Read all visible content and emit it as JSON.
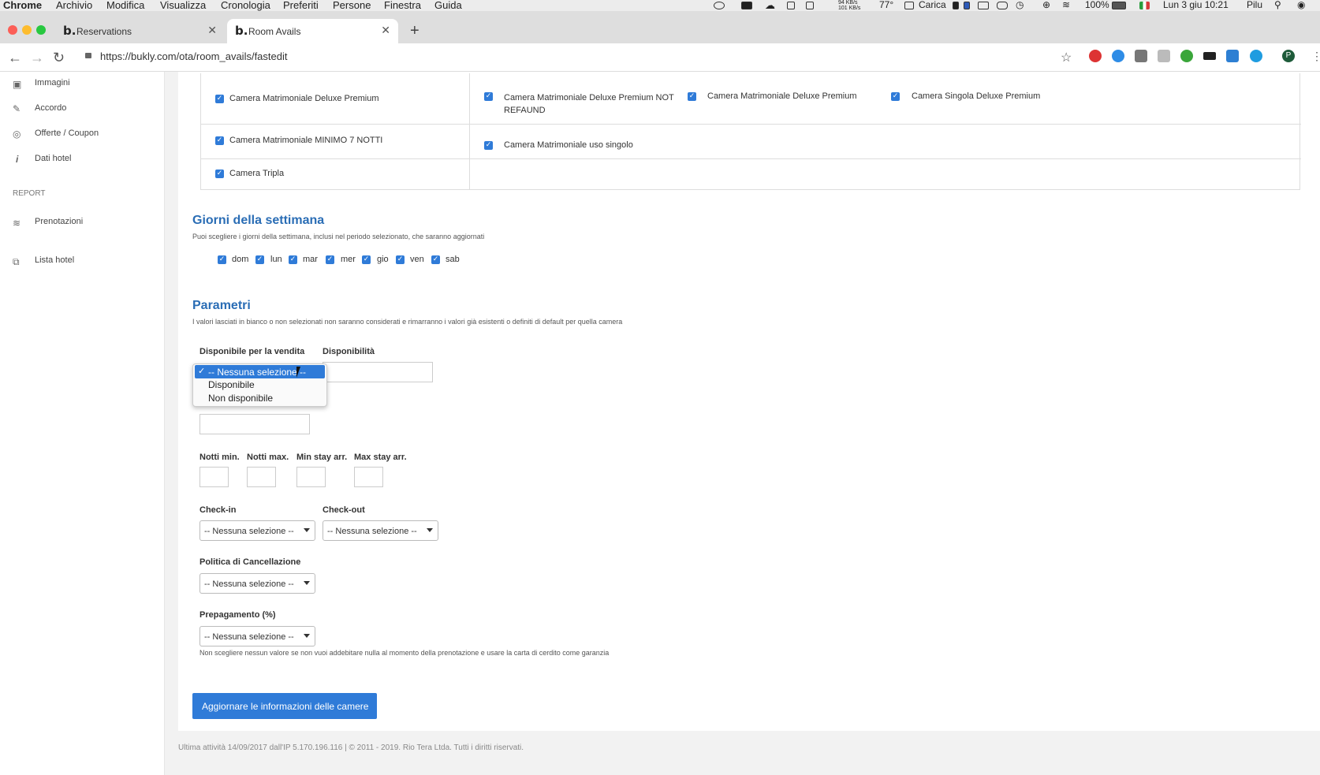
{
  "menubar": {
    "app": "Chrome",
    "items": [
      "Archivio",
      "Modifica",
      "Visualizza",
      "Cronologia",
      "Preferiti",
      "Persone",
      "Finestra",
      "Guida"
    ],
    "status": {
      "net_up": "94 KB/s",
      "net_down": "101 KB/s",
      "temp": "77°",
      "power": "Carica",
      "battery": "100%",
      "datetime": "Lun 3 giu 10:21",
      "user": "Pilu"
    }
  },
  "tabs": [
    {
      "favicon": "b.",
      "label": "Reservations"
    },
    {
      "favicon": "b.",
      "label": "Room Avails"
    }
  ],
  "url": "https://bukly.com/ota/room_avails/fastedit",
  "profile_initial": "P",
  "sidebar": {
    "items": [
      {
        "label": "Immagini",
        "icon": "image-icon"
      },
      {
        "label": "Accordo",
        "icon": "pen-icon"
      },
      {
        "label": "Offerte / Coupon",
        "icon": "target-icon"
      },
      {
        "label": "Dati hotel",
        "icon": "info-icon"
      }
    ],
    "report_label": "REPORT",
    "report_items": [
      {
        "label": "Prenotazioni",
        "icon": "layers-icon"
      },
      {
        "label": "Lista hotel",
        "icon": "puzzle-icon"
      }
    ]
  },
  "rooms": {
    "row1_left": "Camera Matrimoniale Deluxe Premium",
    "row1_right": [
      "Camera Matrimoniale Deluxe Premium NOT REFAUND",
      "Camera Matrimoniale Deluxe Premium",
      "Camera Singola Deluxe Premium"
    ],
    "row2_left": "Camera Matrimoniale MINIMO 7 NOTTI",
    "row2_right": [
      "Camera Matrimoniale uso singolo"
    ],
    "row3_left": "Camera Tripla"
  },
  "days": {
    "title": "Giorni della settimana",
    "hint": "Puoi scegliere i giorni della settimana, inclusi nel periodo selezionato, che saranno aggiornati",
    "items": [
      "dom",
      "lun",
      "mar",
      "mer",
      "gio",
      "ven",
      "sab"
    ]
  },
  "params": {
    "title": "Parametri",
    "hint": "I valori lasciati in bianco o non selezionati non saranno considerati e rimarranno i valori già esistenti o definiti di default per quella camera",
    "avail_sale_label": "Disponibile per la vendita",
    "availability_label": "Disponibilità",
    "dropdown_options": [
      "-- Nessuna selezione --",
      "Disponibile",
      "Non disponibile"
    ],
    "min_nights": "Notti min.",
    "max_nights": "Notti max.",
    "min_stay_arr": "Min stay arr.",
    "max_stay_arr": "Max stay arr.",
    "checkin_label": "Check-in",
    "checkout_label": "Check-out",
    "cancel_label": "Politica di Cancellazione",
    "prepay_label": "Prepagamento (%)",
    "none_selected": "-- Nessuna selezione --",
    "prepay_hint": "Non scegliere nessun valore se non vuoi addebitare nulla al momento della prenotazione e usare la carta di cerdito come garanzia",
    "submit_label": "Aggiornare le informazioni delle camere"
  },
  "footer": "Ultima attività 14/09/2017 dall'IP 5.170.196.116 | © 2011 - 2019. Rio Tera Ltda. Tutti i diritti riservati.",
  "colors": {
    "accent": "#2f7bd8",
    "heading": "#2a6db5"
  }
}
